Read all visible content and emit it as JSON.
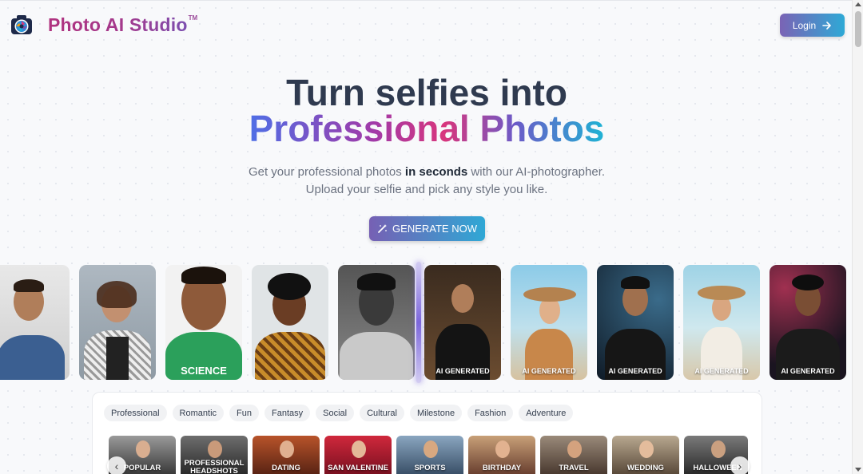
{
  "header": {
    "brand": "Photo AI Studio",
    "trademark": "TM",
    "login_label": "Login"
  },
  "hero": {
    "title_line1": "Turn selfies into",
    "title_line2": "Professional Photos",
    "subtitle_pre": "Get your professional photos ",
    "subtitle_bold": "in seconds",
    "subtitle_post": " with our AI-photographer.",
    "subtitle_line2": "Upload your selfie and pick any style you like.",
    "cta_label": "GENERATE NOW"
  },
  "gallery": {
    "ai_badge": "AI GENERATED",
    "science_shirt": "SCIENCE"
  },
  "style_tags": [
    "Professional",
    "Romantic",
    "Fun",
    "Fantasy",
    "Social",
    "Cultural",
    "Milestone",
    "Fashion",
    "Adventure"
  ],
  "categories": [
    {
      "line1": "POPULAR",
      "line2": ""
    },
    {
      "line1": "PROFESSIONAL",
      "line2": "HEADSHOTS"
    },
    {
      "line1": "DATING",
      "line2": ""
    },
    {
      "line1": "SAN VALENTINE",
      "line2": ""
    },
    {
      "line1": "SPORTS",
      "line2": ""
    },
    {
      "line1": "BIRTHDAY",
      "line2": ""
    },
    {
      "line1": "TRAVEL",
      "line2": ""
    },
    {
      "line1": "WEDDING",
      "line2": ""
    },
    {
      "line1": "HALLOWEEN",
      "line2": ""
    }
  ],
  "colors": {
    "brand_pink": "#b0337f",
    "accent_purple": "#7a63b5",
    "accent_cyan": "#2ea9d6",
    "title_dark": "#2f3a4f"
  },
  "icons": {
    "logo": "camera-aperture-icon",
    "login": "arrow-right-icon",
    "cta": "magic-wand-icon",
    "carousel_prev": "chevron-left-icon",
    "carousel_next": "chevron-right-icon"
  }
}
